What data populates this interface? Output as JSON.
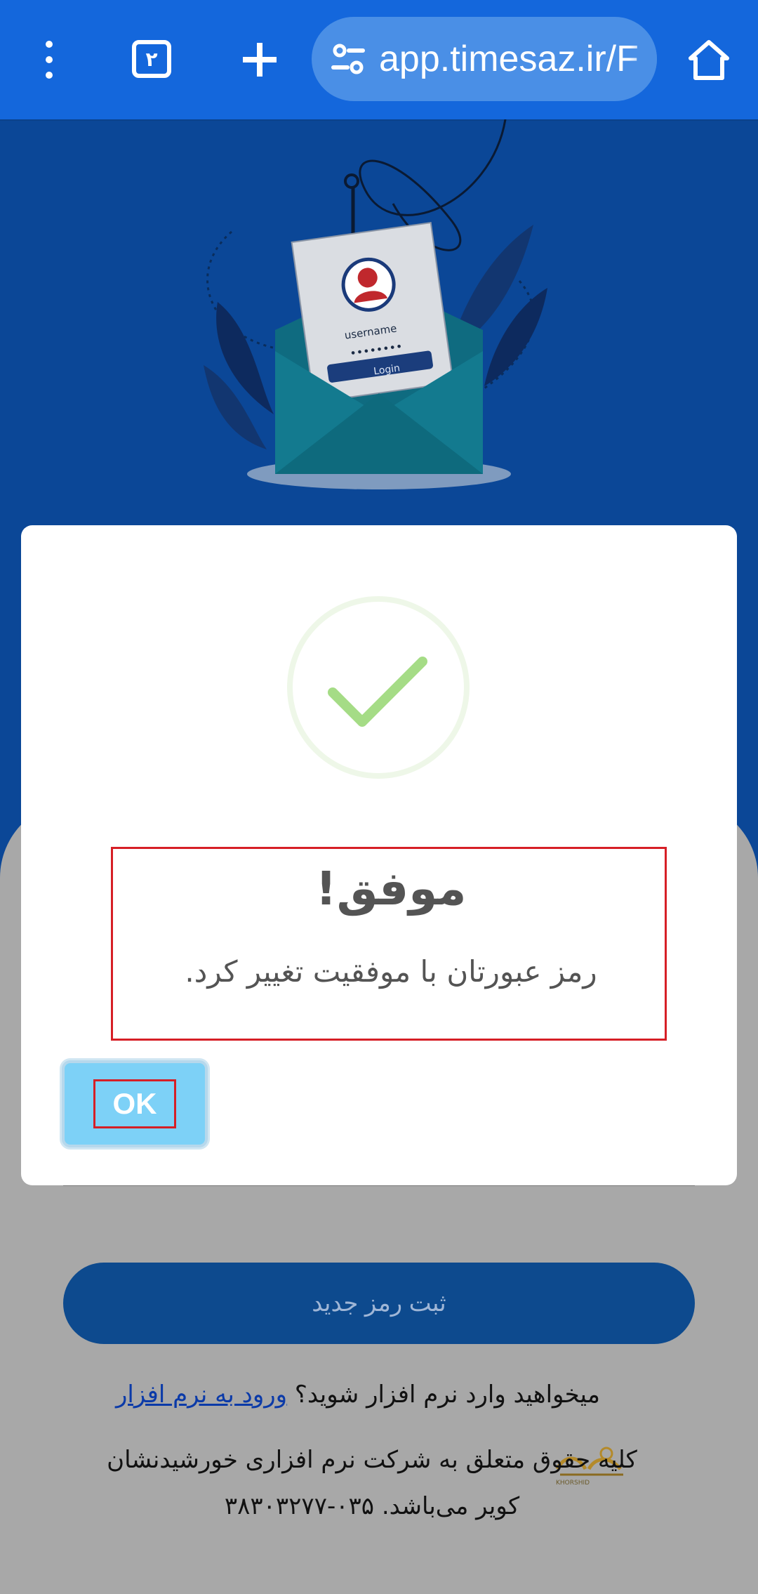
{
  "browser": {
    "tab_count": "۲",
    "url": "app.timesaz.ir/F",
    "icons": {
      "menu": "kebab-menu-icon",
      "tabs": "tab-switcher-icon",
      "new_tab": "plus-icon",
      "site_info": "tune-icon",
      "home": "home-icon"
    }
  },
  "hero": {
    "card_username": "username",
    "card_password": "••••••••",
    "card_login": "Login"
  },
  "page": {
    "submit_label": "ثبت رمز جدید",
    "question": "میخواهید وارد نرم افزار شوید؟ ",
    "login_link": "ورود به نرم افزار",
    "copyright": "کلیه حقوق متعلق به شرکت نرم افزاری خورشیدنشان کویر می‌باشد. ۰۳۵-۳۸۳۰۳۲۷۷",
    "logo_text": "KHORSHID"
  },
  "dialog": {
    "title": "موفق!",
    "message": "رمز عبورتان با موفقیت تغییر کرد.",
    "ok_label": "OK",
    "icon": "success-check-icon",
    "accent": "#a5dc86",
    "ok_color": "#7dd1f7"
  }
}
